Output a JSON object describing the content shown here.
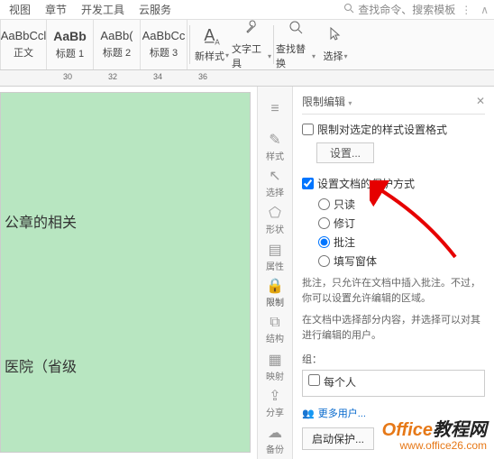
{
  "top_tabs": {
    "view": "视图",
    "chapter": "章节",
    "dev": "开发工具",
    "cloud": "云服务",
    "search_placeholder": "查找命令、搜索模板"
  },
  "ribbon": {
    "styles": [
      {
        "preview": "AaBbCcl",
        "label": "正文",
        "bold": false
      },
      {
        "preview": "AaBb",
        "label": "标题 1",
        "bold": true
      },
      {
        "preview": "AaBb(",
        "label": "标题 2",
        "bold": false
      },
      {
        "preview": "AaBbCc",
        "label": "标题 3",
        "bold": false
      }
    ],
    "new_style": "新样式",
    "text_tool": "文字工具",
    "find_replace": "查找替换",
    "select": "选择"
  },
  "ruler_ticks": [
    "30",
    "32",
    "34",
    "36"
  ],
  "doc": {
    "line1": "公章的相关",
    "line2": "医院（省级"
  },
  "side": {
    "menu": "",
    "style": "样式",
    "select": "选择",
    "shape": "形状",
    "attr": "属性",
    "restrict": "限制",
    "struct": "结构",
    "map": "映射",
    "share": "分享",
    "backup": "备份"
  },
  "panel": {
    "title": "限制编辑",
    "restrict_style": "限制对选定的样式设置格式",
    "settings_btn": "设置...",
    "protect_method": "设置文档的保护方式",
    "radio_readonly": "只读",
    "radio_revision": "修订",
    "radio_comment": "批注",
    "radio_fillform": "填写窗体",
    "hint1": "批注，只允许在文档中插入批注。不过，你可以设置允许编辑的区域。",
    "hint2": "在文档中选择部分内容，并选择可以对其进行编辑的用户。",
    "group_label": "组：",
    "everyone": "每个人",
    "more_users": "更多用户...",
    "start_protect": "启动保护..."
  },
  "watermark": {
    "line1a": "Office",
    "line1b": "教程网",
    "line2": "www.office26.com"
  }
}
